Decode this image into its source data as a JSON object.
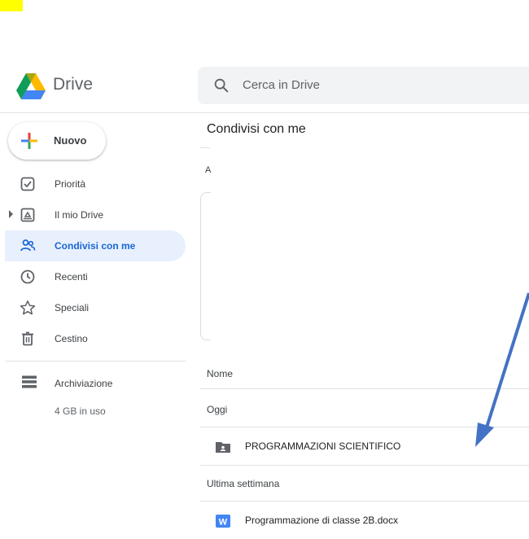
{
  "app": {
    "name": "Drive"
  },
  "search": {
    "placeholder": "Cerca in Drive"
  },
  "sidebar": {
    "new_button": "Nuovo",
    "items": [
      {
        "label": "Priorità",
        "icon": "checkbox-icon"
      },
      {
        "label": "Il mio Drive",
        "icon": "drive-icon"
      },
      {
        "label": "Condivisi con me",
        "icon": "shared-icon",
        "active": true
      },
      {
        "label": "Recenti",
        "icon": "clock-icon"
      },
      {
        "label": "Speciali",
        "icon": "star-icon"
      },
      {
        "label": "Cestino",
        "icon": "trash-icon"
      }
    ],
    "storage": {
      "label": "Archiviazione",
      "usage": "4 GB in uso"
    }
  },
  "main": {
    "title": "Condivisi con me",
    "fragment": "A",
    "column_name": "Nome",
    "groups": [
      {
        "label": "Oggi",
        "files": [
          {
            "name": "PROGRAMMAZIONI SCIENTIFICO",
            "type": "shared-folder"
          }
        ]
      },
      {
        "label": "Ultima settimana",
        "files": [
          {
            "name": "Programmazione di classe 2B.docx",
            "type": "word-doc"
          }
        ]
      }
    ]
  },
  "colors": {
    "accent": "#1967d2",
    "active_bg": "#e8f0fe",
    "arrow": "#4472c4",
    "highlight": "#ffff00"
  }
}
